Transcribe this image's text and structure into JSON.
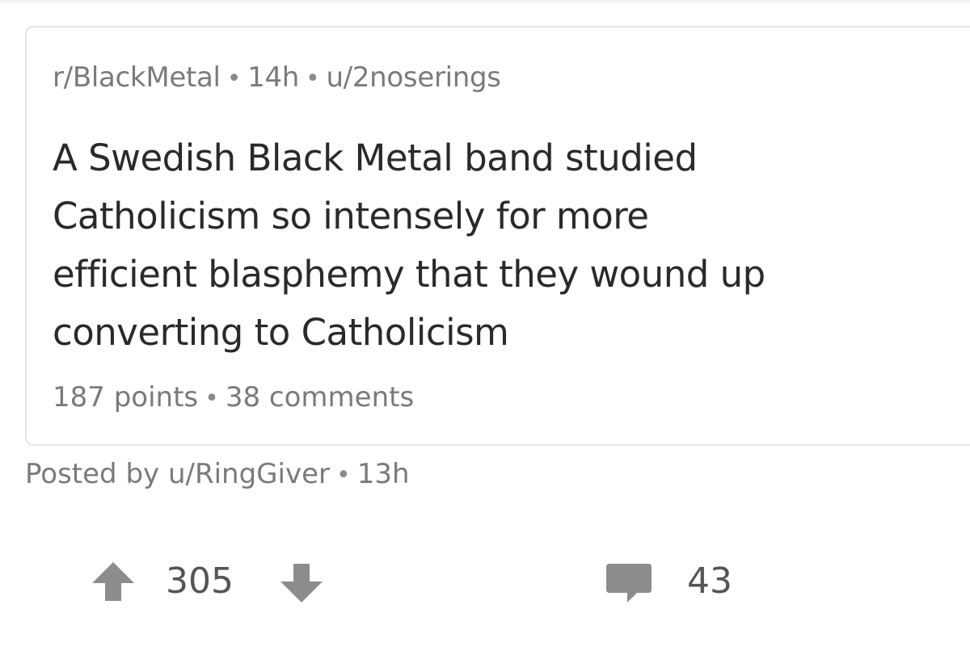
{
  "crosspost": {
    "subreddit": "r/BlackMetal",
    "age": "14h",
    "author": "u/2noserings",
    "separator": "•",
    "title_lines": [
      "A Swedish Black Metal band studied",
      "Catholicism so intensely for more",
      "efficient blasphemy that they wound up",
      "converting to Catholicism"
    ],
    "points": "187 points",
    "comments": "38 comments"
  },
  "post": {
    "posted_by": "Posted by u/RingGiver",
    "separator": "•",
    "age": "13h",
    "score": "305",
    "comment_count": "43"
  },
  "icons": {
    "upvote": "upvote-arrow-icon",
    "downvote": "downvote-arrow-icon",
    "comments": "comment-bubble-icon"
  },
  "colors": {
    "meta_text": "#7a7a7a",
    "title_text": "#2a2a2a",
    "icon_gray": "#8c8c8c",
    "card_border": "#e4e4e4"
  }
}
